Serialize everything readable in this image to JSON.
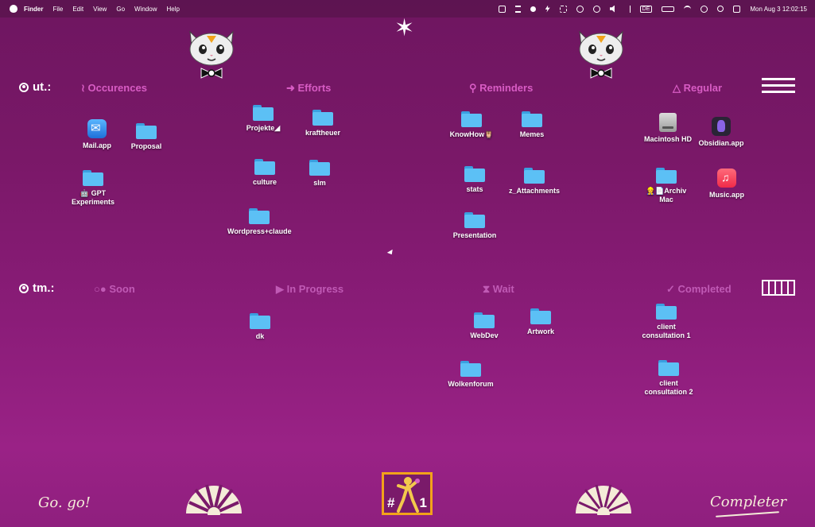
{
  "menubar": {
    "app": "Finder",
    "items": [
      "File",
      "Edit",
      "View",
      "Go",
      "Window",
      "Help"
    ],
    "input_source": "DE",
    "clock": "Mon Aug 3  12:02:15"
  },
  "rows": {
    "ut": "ut.:",
    "tm": "tm.:"
  },
  "columns_top": {
    "occurences": "≀ Occurences",
    "efforts": "➜ Efforts",
    "reminders": "⚲ Reminders",
    "regular": "△ Regular"
  },
  "columns_bottom": {
    "soon": "○● Soon",
    "in_progress": "▶ In Progress",
    "wait": "⧗ Wait",
    "completed": "✓ Completed"
  },
  "desktop": {
    "mail": "Mail.app",
    "proposal": "Proposal",
    "gpt": "🤖 GPT Experiments",
    "projekte": "Projekte◢",
    "kraftheuer": "kraftheuer",
    "culture": "culture",
    "slm": "slm",
    "wordpress": "Wordpress+claude",
    "knowhow": "KnowHow🦉",
    "memes": "Memes",
    "stats": "stats",
    "attachments": "z_Attachments",
    "presentation": "Presentation",
    "macintosh": "Macintosh HD",
    "obsidian": "Obsidian.app",
    "archiv": "👷📄Archiv Mac",
    "music": "Music.app",
    "dk": "dk",
    "webdev": "WebDev",
    "artwork": "Artwork",
    "wolkenforum": "Wolkenforum",
    "client1": "client consultation 1",
    "client2": "client consultation 2"
  },
  "footer": {
    "go": "Go. go!",
    "completer": "Completer",
    "badge_hash": "#",
    "badge_one": "1"
  },
  "colors": {
    "accent_pink": "#d85cc4",
    "folder_blue": "#5cc0f5",
    "badge_orange": "#f2a21a",
    "cream": "#f4ecd8"
  }
}
